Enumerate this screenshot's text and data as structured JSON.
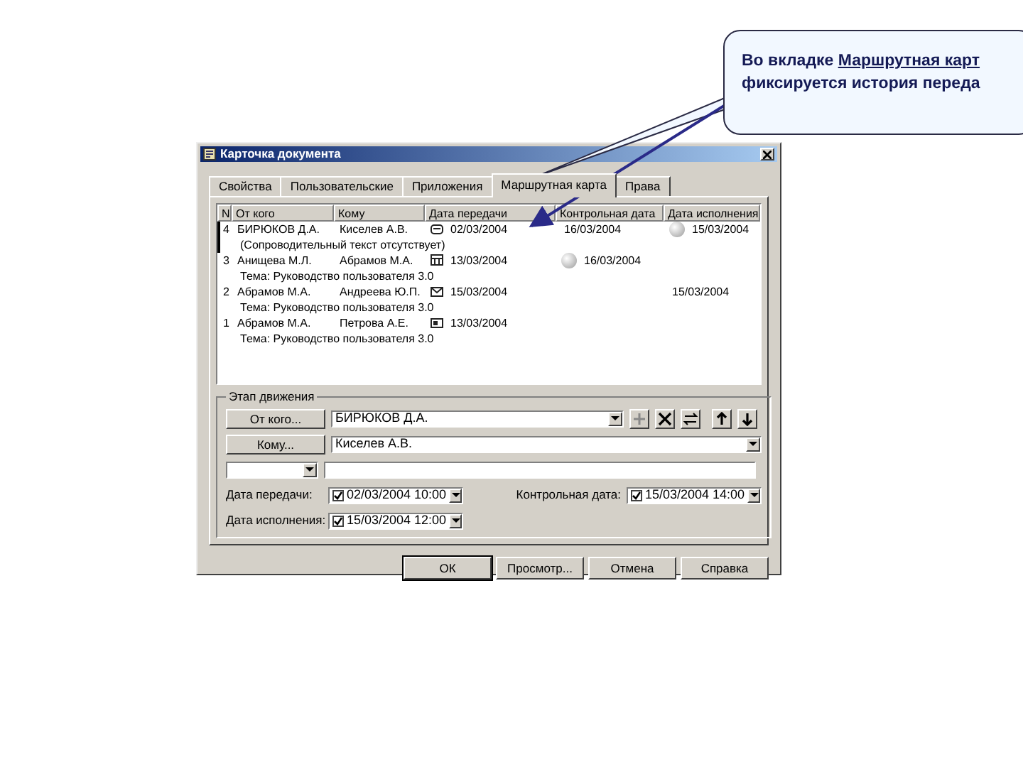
{
  "callout": {
    "text_start": "Во вкладке",
    "link": "Маршрутная карт",
    "text_end": "фиксируется история переда"
  },
  "window": {
    "title": "Карточка документа"
  },
  "tabs": [
    {
      "label": "Свойства",
      "selected": false
    },
    {
      "label": "Пользовательские",
      "selected": false
    },
    {
      "label": "Приложения",
      "selected": false
    },
    {
      "label": "Маршрутная карта",
      "selected": true
    },
    {
      "label": "Права",
      "selected": false
    }
  ],
  "table": {
    "columns": [
      "N",
      "От кого",
      "Кому",
      "Дата передачи",
      "Контрольная дата",
      "Дата исполнения"
    ],
    "rows": [
      {
        "n": "4",
        "from": "БИРЮКОВ Д.А.",
        "to": "Киселев А.В.",
        "sent": "02/03/2004",
        "control": "16/03/2004",
        "control_flag": false,
        "done": "15/03/2004",
        "done_flag": true,
        "note": "(Сопроводительный текст отсутствует)",
        "selected": true
      },
      {
        "n": "3",
        "from": "Анищева М.Л.",
        "to": "Абрамов М.А.",
        "sent": "13/03/2004",
        "control": "16/03/2004",
        "control_flag": true,
        "done": "",
        "done_flag": false,
        "note": "Тема: Руководство пользователя 3.0",
        "selected": false
      },
      {
        "n": "2",
        "from": "Абрамов М.А.",
        "to": "Андреева Ю.П.",
        "sent": "15/03/2004",
        "control": "",
        "control_flag": false,
        "done": "15/03/2004",
        "done_flag": false,
        "note": "Тема: Руководство пользователя 3.0",
        "selected": false
      },
      {
        "n": "1",
        "from": "Абрамов М.А.",
        "to": "Петрова А.Е.",
        "sent": "13/03/2004",
        "control": "",
        "control_flag": false,
        "done": "",
        "done_flag": false,
        "note": "Тема: Руководство пользователя 3.0",
        "selected": false
      }
    ]
  },
  "stage": {
    "title": "Этап движения",
    "from_button": "От кого...",
    "from_value": "БИРЮКОВ Д.А.",
    "to_button": "Кому...",
    "to_value": "Киселев А.В.",
    "sent_label": "Дата передачи:",
    "sent": {
      "value": "02/03/2004  10:00",
      "checked": true
    },
    "control_label": "Контрольная дата:",
    "control": {
      "value": "15/03/2004  14:00",
      "checked": true
    },
    "done_label": "Дата исполнения:",
    "done": {
      "value": "15/03/2004  12:00",
      "checked": true
    }
  },
  "buttons": [
    {
      "label": "ОК",
      "default": true
    },
    {
      "label": "Просмотр...",
      "default": false
    },
    {
      "label": "Отмена",
      "default": false
    },
    {
      "label": "Справка",
      "default": false
    }
  ]
}
